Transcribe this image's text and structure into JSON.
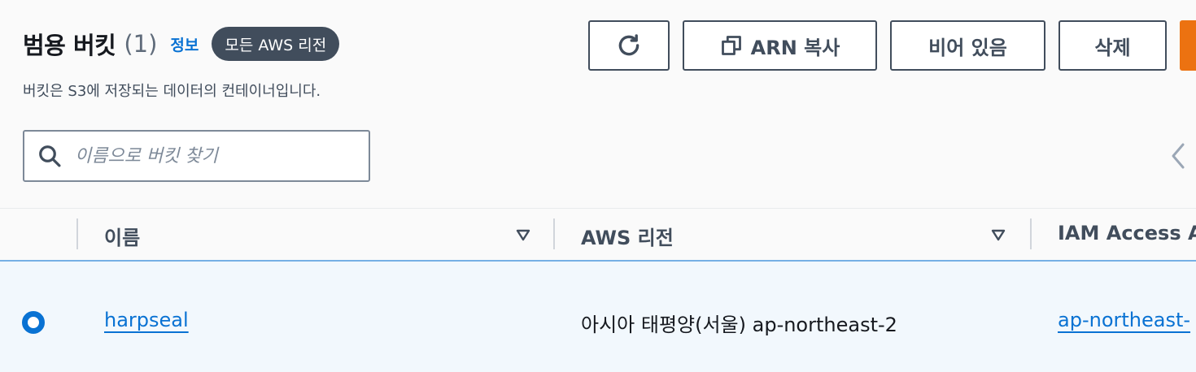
{
  "header": {
    "title": "범용 버킷",
    "count": "(1)",
    "info_link": "정보",
    "region_badge": "모든 AWS 리전",
    "description": "버킷은 S3에 저장되는 데이터의 컨테이너입니다."
  },
  "toolbar": {
    "refresh_icon": "refresh-icon",
    "copy_icon": "copy-icon",
    "copy_arn_label": "ARN 복사",
    "empty_label": "비어 있음",
    "delete_label": "삭제"
  },
  "search": {
    "placeholder": "이름으로 버킷 찾기",
    "value": ""
  },
  "table": {
    "columns": [
      "이름",
      "AWS 리전",
      "IAM Access A"
    ],
    "rows": [
      {
        "selected": true,
        "name": "harpseal",
        "region": "아시아 태평양(서울) ap-northeast-2",
        "iam_access_analyzer": "ap-northeast-"
      }
    ]
  },
  "colors": {
    "link": "#0972d3",
    "primary_button": "#ec7211",
    "badge": "#414d5c",
    "selected_row": "#f2f8fd"
  }
}
